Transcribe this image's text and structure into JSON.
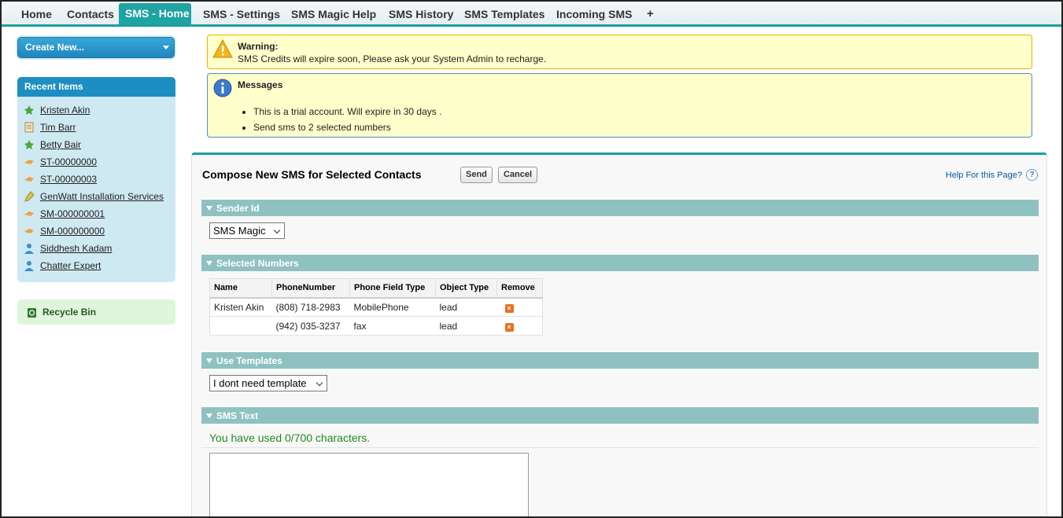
{
  "tabs": [
    {
      "label": "Home",
      "active": false
    },
    {
      "label": "Contacts",
      "active": false
    },
    {
      "label": "SMS - Home",
      "active": true
    },
    {
      "label": "SMS - Settings",
      "active": false
    },
    {
      "label": "SMS Magic Help",
      "active": false
    },
    {
      "label": "SMS History",
      "active": false
    },
    {
      "label": "SMS Templates",
      "active": false
    },
    {
      "label": "Incoming SMS",
      "active": false
    },
    {
      "label": "+",
      "active": false
    }
  ],
  "sidebar": {
    "create_new": "Create New...",
    "recent_title": "Recent Items",
    "recent_items": [
      {
        "label": "Kristen Akin",
        "icon": "lead-icon"
      },
      {
        "label": "Tim Barr",
        "icon": "contact-card-icon"
      },
      {
        "label": "Betty Bair",
        "icon": "lead-icon"
      },
      {
        "label": "ST-00000000",
        "icon": "custom-object-icon"
      },
      {
        "label": "ST-00000003",
        "icon": "custom-object-icon"
      },
      {
        "label": "GenWatt Installation Services",
        "icon": "opportunity-icon"
      },
      {
        "label": "SM-000000001",
        "icon": "custom-object-icon"
      },
      {
        "label": "SM-000000000",
        "icon": "custom-object-icon"
      },
      {
        "label": "Siddhesh Kadam",
        "icon": "user-icon"
      },
      {
        "label": "Chatter Expert",
        "icon": "user-icon"
      }
    ],
    "recycle_bin": "Recycle Bin"
  },
  "warning": {
    "title": "Warning:",
    "text": "SMS Credits will expire soon, Please ask your System Admin to recharge."
  },
  "messages": {
    "title": "Messages",
    "items": [
      "This is a trial account. Will expire in 30 days .",
      "Send sms to 2 selected numbers"
    ]
  },
  "compose": {
    "title": "Compose New SMS for Selected Contacts",
    "send": "Send",
    "cancel": "Cancel",
    "help": "Help For this Page?",
    "help_icon": "?",
    "sender_section": "Sender Id",
    "sender_value": "SMS Magic",
    "numbers_section": "Selected Numbers",
    "table_headers": [
      "Name",
      "PhoneNumber",
      "Phone Field Type",
      "Object Type",
      "Remove"
    ],
    "rows": [
      {
        "name": "Kristen Akin",
        "phone": "(808) 718-2983",
        "field": "MobilePhone",
        "object": "lead"
      },
      {
        "name": "",
        "phone": "(942) 035-3237",
        "field": "fax",
        "object": "lead"
      }
    ],
    "templates_section": "Use Templates",
    "template_value": "I dont need template",
    "text_section": "SMS Text",
    "counter": "You have used 0/700 characters.",
    "sms_text": ""
  },
  "colors": {
    "accent_teal": "#1fa3a3",
    "section_header": "#8fc1c1",
    "sidebar_blue": "#1c8ec2",
    "warning_bg": "#ffffcc",
    "counter_green": "#1e8a1e",
    "remove_orange": "#e8701a"
  }
}
